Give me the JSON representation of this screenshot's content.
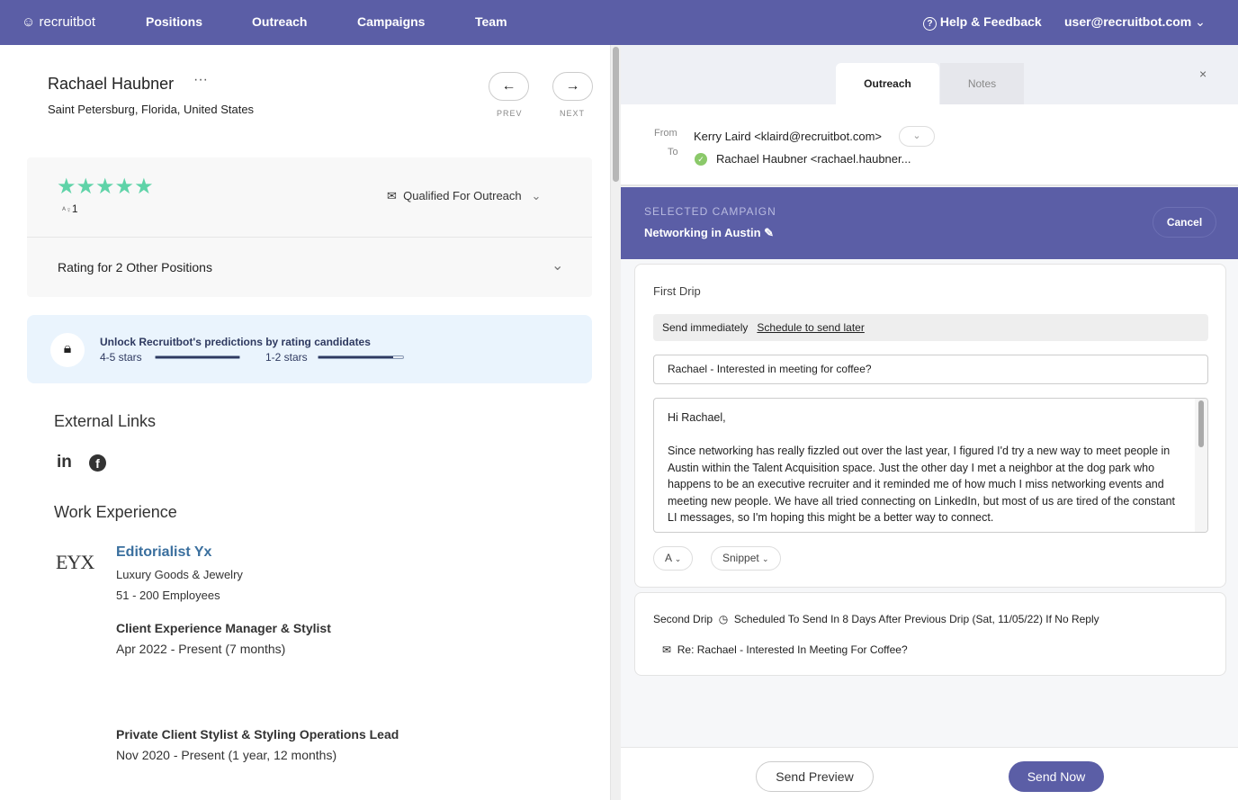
{
  "nav": {
    "logo": "recruitbot",
    "items": [
      "Positions",
      "Outreach",
      "Campaigns",
      "Team"
    ],
    "help": "Help & Feedback",
    "user": "user@recruitbot.com"
  },
  "candidate": {
    "name": "Rachael Haubner",
    "location": "Saint Petersburg, Florida, United States",
    "prev": "PREV",
    "next": "NEXT"
  },
  "rating": {
    "stars": 5,
    "raters": "1",
    "status": "Qualified For Outreach",
    "other": "Rating for 2 Other Positions"
  },
  "unlock": {
    "title": "Unlock Recruitbot's predictions by rating candidates",
    "high_label": "4-5 stars",
    "high_progress": 100,
    "low_label": "1-2 stars",
    "low_progress": 88
  },
  "links": {
    "title": "External Links",
    "icons": [
      "linkedin-icon",
      "facebook-icon"
    ]
  },
  "work": {
    "title": "Work Experience",
    "company": "Editorialist Yx",
    "logo_text": "EYX",
    "industry": "Luxury Goods & Jewelry",
    "size": "51 - 200 Employees",
    "roles": [
      {
        "title": "Client Experience Manager & Stylist",
        "dates": "Apr 2022 - Present (7 months)"
      },
      {
        "title": "Private Client Stylist & Styling Operations Lead",
        "dates": "Nov 2020 - Present (1 year, 12 months)"
      }
    ]
  },
  "panel": {
    "tabs": [
      "Outreach",
      "Notes"
    ],
    "from_label": "From",
    "to_label": "To",
    "from": "Kerry Laird <klaird@recruitbot.com>",
    "to": "Rachael Haubner <rachael.haubner...",
    "campaign_label": "SELECTED CAMPAIGN",
    "campaign": "Networking in Austin",
    "cancel": "Cancel",
    "drip1": {
      "title": "First Drip",
      "send_now": "Send immediately",
      "schedule": "Schedule to send later",
      "subject": "Rachael - Interested in meeting for coffee?",
      "body": [
        "Hi Rachael,",
        "Since networking has really fizzled out over the last year, I figured I'd try a new way to meet people in Austin within the Talent Acquisition space. Just the other day I met a neighbor at the dog park who happens to be an executive recruiter and it reminded me of how much I miss networking events and meeting new people. We have all tried connecting on LinkedIn, but most of us are tired of the constant LI messages, so I'm hoping this might be a better way to connect."
      ],
      "font_btn": "A",
      "snippet_btn": "Snippet"
    },
    "drip2": {
      "title": "Second Drip",
      "schedule": "Scheduled To Send In 8 Days After Previous Drip (Sat, 11/05/22) If No Reply",
      "subject": "Re: Rachael - Interested In Meeting For Coffee?"
    },
    "send_preview": "Send Preview",
    "send_now": "Send Now"
  },
  "colors": {
    "brand": "#5b5ea6",
    "star": "#5fd3a8",
    "link": "#3a6f9e"
  }
}
